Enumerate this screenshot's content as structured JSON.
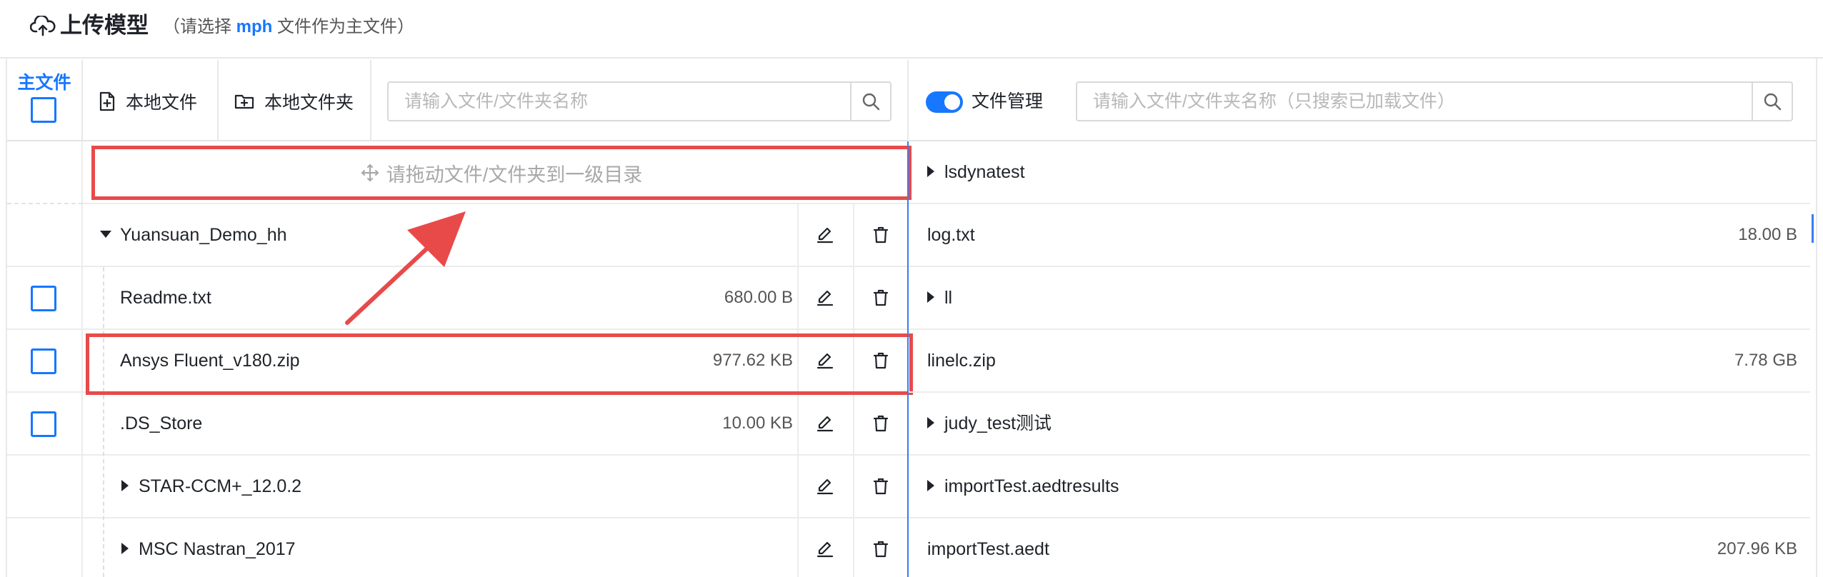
{
  "header": {
    "title": "上传模型",
    "subtitle_prefix": "（请选择 ",
    "subtitle_highlight": "mph",
    "subtitle_suffix": " 文件作为主文件）"
  },
  "toolbar": {
    "main_file_label": "主文件",
    "local_file_label": "本地文件",
    "local_folder_label": "本地文件夹",
    "left_search_placeholder": "请输入文件/文件夹名称",
    "file_manage_label": "文件管理",
    "right_search_placeholder": "请输入文件/文件夹名称（只搜索已加载文件）"
  },
  "drop_zone": {
    "text": "请拖动文件/文件夹到一级目录"
  },
  "left_tree": [
    {
      "name": "Yuansuan_Demo_hh",
      "size": "",
      "kind": "folder-open"
    },
    {
      "name": "Readme.txt",
      "size": "680.00 B",
      "kind": "file"
    },
    {
      "name": "Ansys Fluent_v180.zip",
      "size": "977.62 KB",
      "kind": "file"
    },
    {
      "name": ".DS_Store",
      "size": "10.00 KB",
      "kind": "file"
    },
    {
      "name": "STAR-CCM+_12.0.2",
      "size": "",
      "kind": "folder"
    },
    {
      "name": "MSC Nastran_2017",
      "size": "",
      "kind": "folder"
    }
  ],
  "right_tree": [
    {
      "name": "lsdynatest",
      "size": "",
      "kind": "folder"
    },
    {
      "name": "log.txt",
      "size": "18.00 B",
      "kind": "file"
    },
    {
      "name": "ll",
      "size": "",
      "kind": "folder"
    },
    {
      "name": "linelc.zip",
      "size": "7.78 GB",
      "kind": "file"
    },
    {
      "name": "judy_test测试",
      "size": "",
      "kind": "folder"
    },
    {
      "name": "importTest.aedtresults",
      "size": "",
      "kind": "folder"
    },
    {
      "name": "importTest.aedt",
      "size": "207.96 KB",
      "kind": "file"
    }
  ],
  "colors": {
    "accent": "#1677ff",
    "annotation_red": "#e84a4a",
    "divider_blue": "#3b7cf0"
  },
  "icons": [
    "upload-cloud-icon",
    "file-add-icon",
    "folder-add-icon",
    "search-icon",
    "edit-icon",
    "trash-icon",
    "caret-right-icon",
    "caret-down-icon",
    "drag-move-icon"
  ]
}
